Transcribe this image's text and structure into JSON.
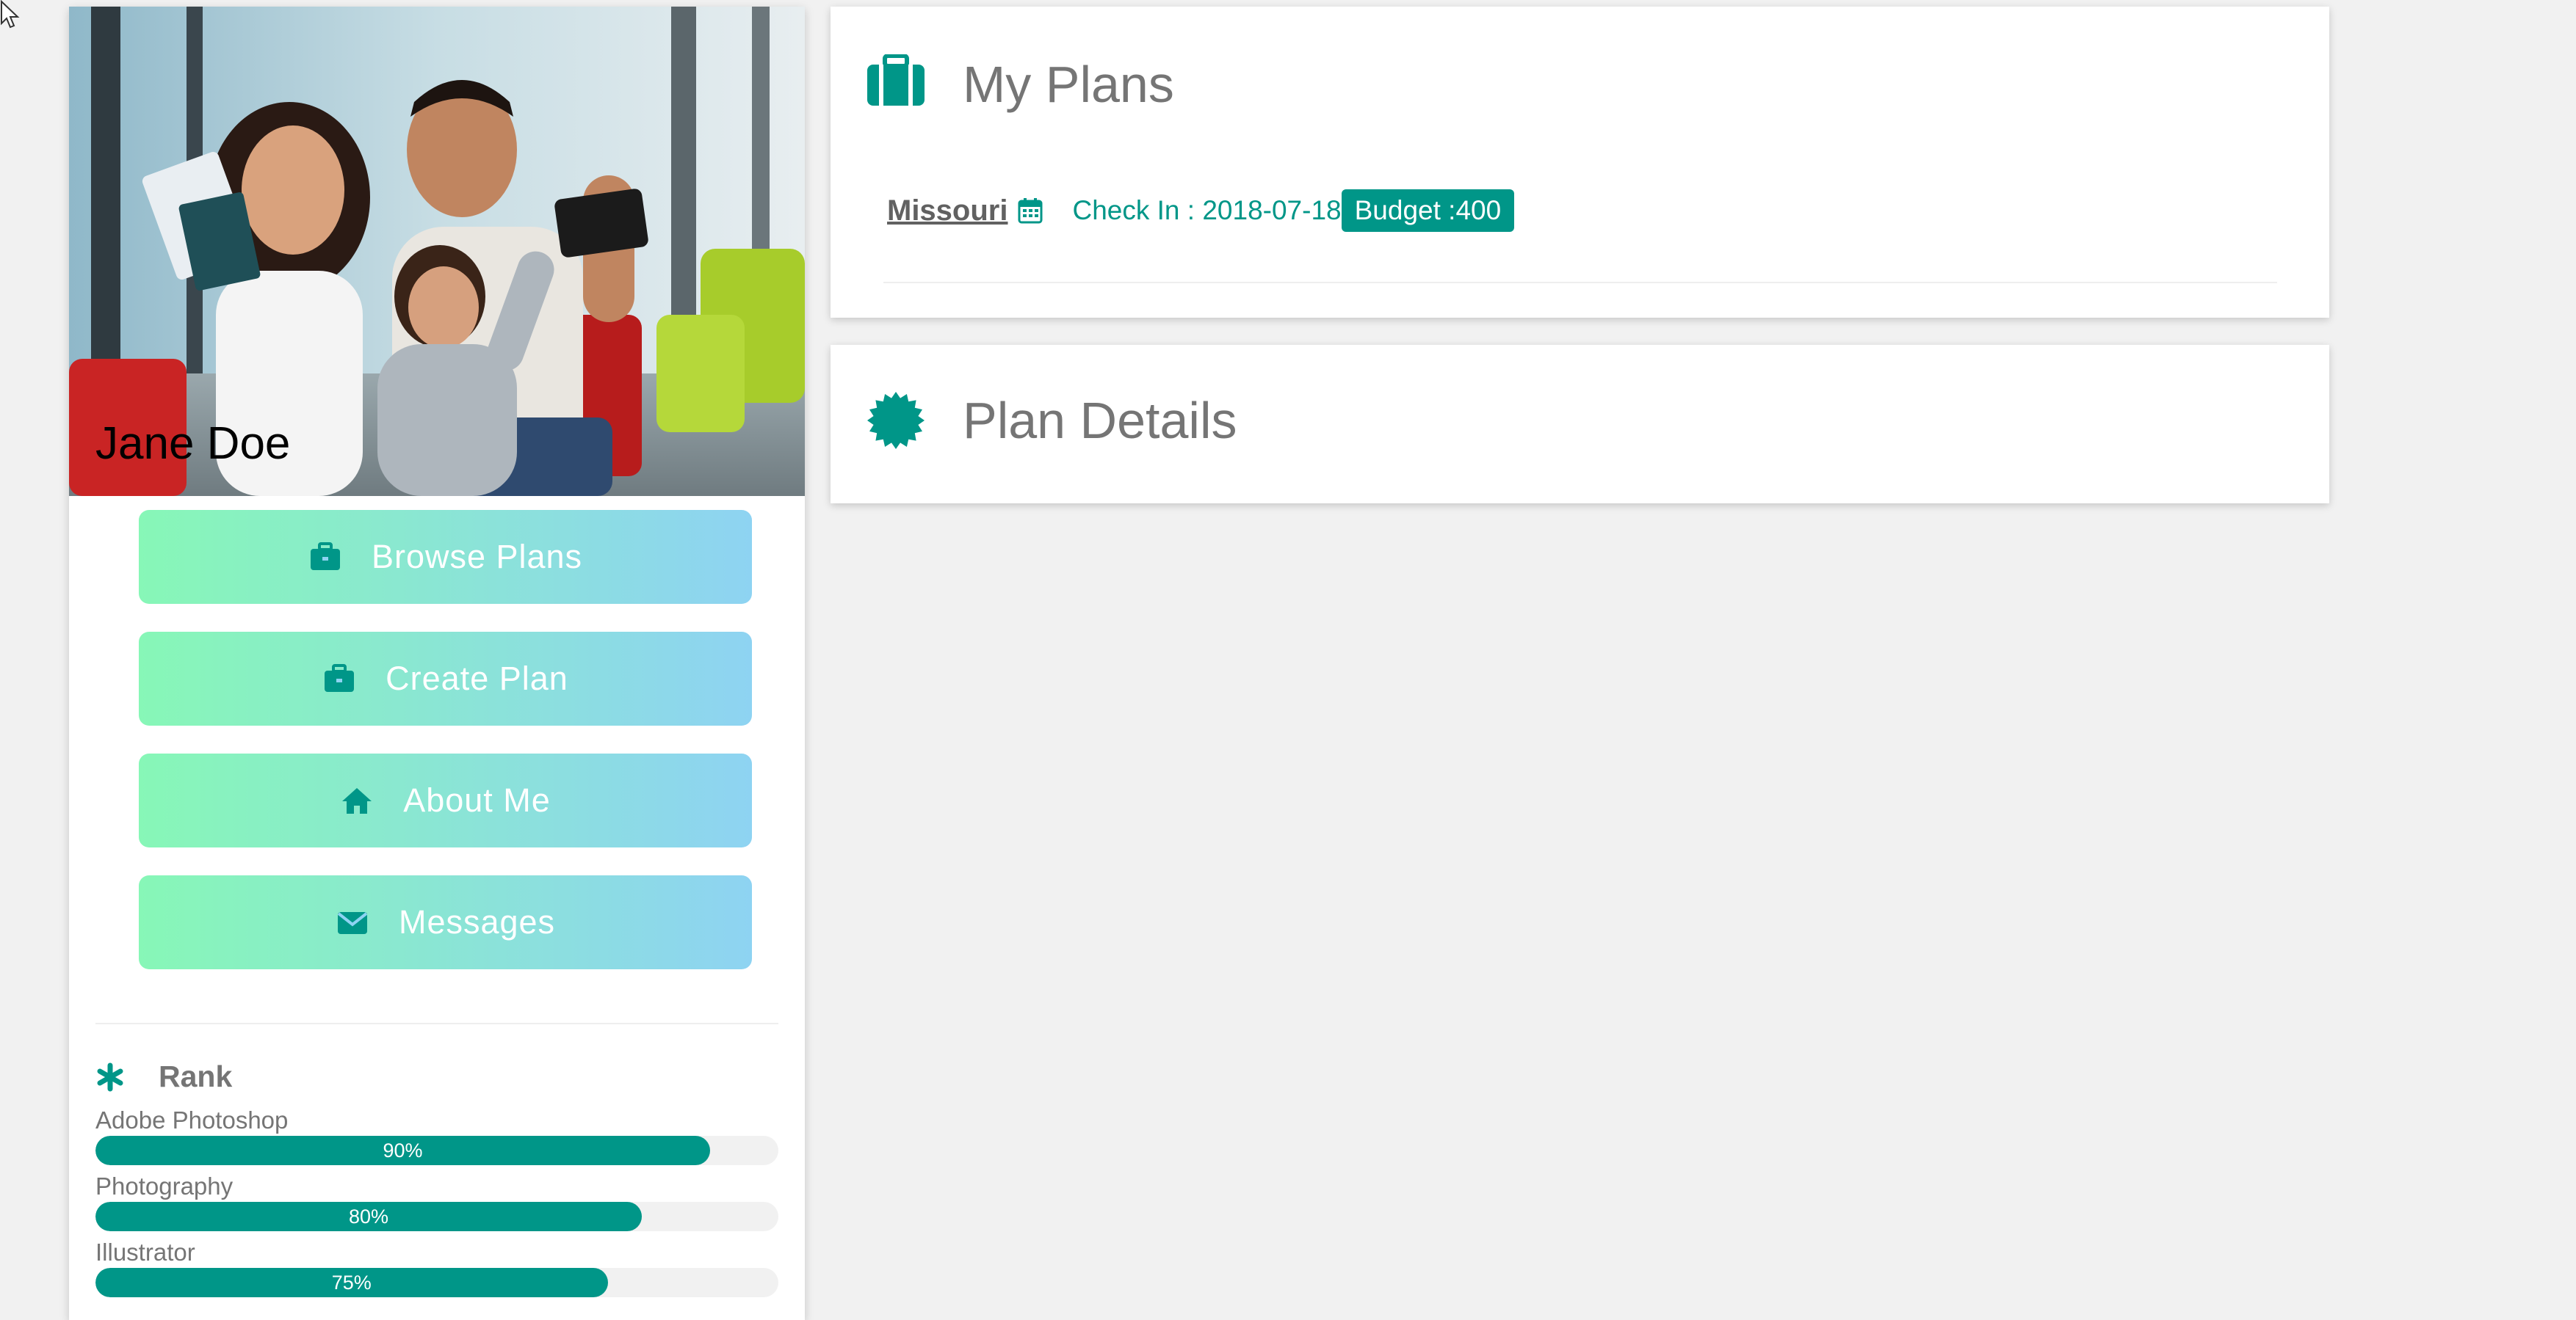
{
  "profile": {
    "name": "Jane Doe",
    "photo_alt": "family-selfie-photo"
  },
  "nav": [
    {
      "label": "Browse Plans",
      "icon": "briefcase-icon"
    },
    {
      "label": "Create Plan",
      "icon": "briefcase-icon"
    },
    {
      "label": "About Me",
      "icon": "home-icon"
    },
    {
      "label": "Messages",
      "icon": "envelope-icon"
    }
  ],
  "rank": {
    "heading": "Rank",
    "icon": "asterisk-icon",
    "skills": [
      {
        "label": "Adobe Photoshop",
        "percent": 90,
        "percent_text": "90%"
      },
      {
        "label": "Photography",
        "percent": 80,
        "percent_text": "80%"
      },
      {
        "label": "Illustrator",
        "percent": 75,
        "percent_text": "75%"
      }
    ]
  },
  "my_plans": {
    "title": "My Plans",
    "icon": "suitcase-icon",
    "plans": [
      {
        "city": "Missouri",
        "checkin": "Check In : 2018-07-18",
        "budget": "Budget :400"
      }
    ]
  },
  "plan_details": {
    "title": "Plan Details",
    "icon": "certificate-icon"
  },
  "colors": {
    "accent": "#009688",
    "gradient_start": "#87f7b7",
    "gradient_end": "#8ed3f2",
    "text_muted": "#757575",
    "background": "#f1f1f1"
  }
}
